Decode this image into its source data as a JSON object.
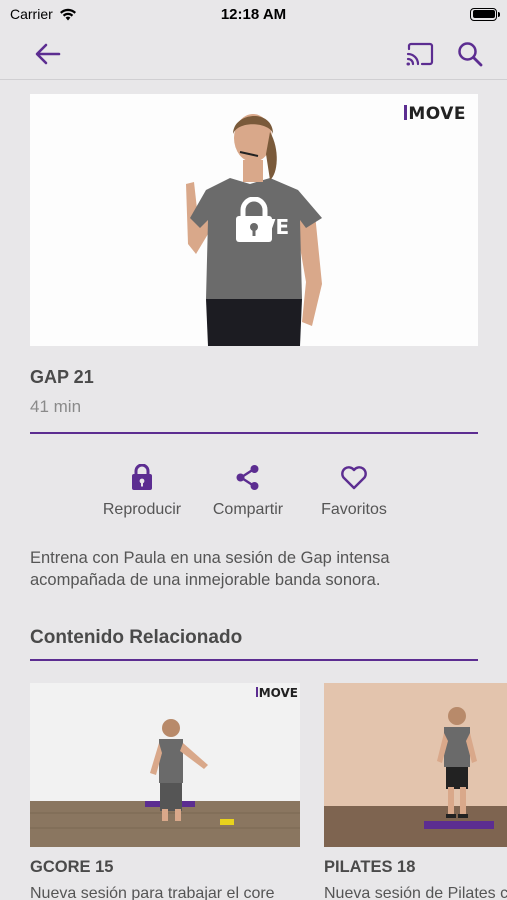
{
  "status": {
    "carrier": "Carrier",
    "time": "12:18 AM"
  },
  "nav": {
    "back_icon": "arrow-left-icon",
    "cast_icon": "cast-icon",
    "search_icon": "search-icon",
    "accent": "#5c2d91"
  },
  "hero": {
    "brand": "MOVE",
    "overlay_icon": "lock-icon"
  },
  "video": {
    "title": "GAP 21",
    "duration": "41 min"
  },
  "actions": [
    {
      "label": "Reproducir",
      "icon": "lock-icon"
    },
    {
      "label": "Compartir",
      "icon": "share-icon"
    },
    {
      "label": "Favoritos",
      "icon": "heart-icon"
    }
  ],
  "description": "Entrena con Paula en una sesión de Gap intensa acompañada de una inmejorable banda sonora.",
  "related": {
    "title": "Contenido Relacionado",
    "items": [
      {
        "title": "GCORE 15",
        "description": "Nueva sesión para trabajar el core",
        "brand": "MOVE"
      },
      {
        "title": "PILATES 18",
        "description": "Nueva sesión de Pilates c"
      }
    ]
  }
}
